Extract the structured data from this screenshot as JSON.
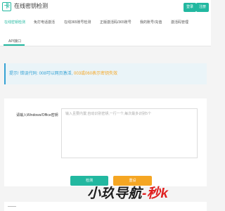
{
  "header": {
    "logo_glyph": "卡",
    "site_title": "在线密钥检测",
    "login_label": "登录",
    "register_label": "注册"
  },
  "nav": {
    "items": [
      {
        "label": "在线密钥检测",
        "active": true
      },
      {
        "label": "免打电话激活"
      },
      {
        "label": "在线365账号检测"
      },
      {
        "label": "正版激活码/365账号"
      },
      {
        "label": "我的账号/充值"
      },
      {
        "label": "激活码管理"
      },
      {
        "label": "API接口"
      }
    ]
  },
  "tip": {
    "prefix": "提示! 错误代码: ",
    "code_008": "008可以网页激活, ",
    "code_003": "003或060表示密钥失效"
  },
  "form": {
    "label": "请输入Windows/Office密钥",
    "placeholder": "输入且要内置;自动识别密钥,一行一个,每次最多识别5个",
    "value": "",
    "check_label": "检测",
    "reset_label": "重设"
  },
  "watermark": {
    "part1": "小玖导航",
    "part2": "-秒k"
  },
  "colors": {
    "accent": "#22b8a0",
    "tip_blue": "#36a2d4",
    "orange": "#f5a623",
    "watermark_red": "#e02020"
  },
  "icons": {
    "logo": "logo-icon"
  }
}
